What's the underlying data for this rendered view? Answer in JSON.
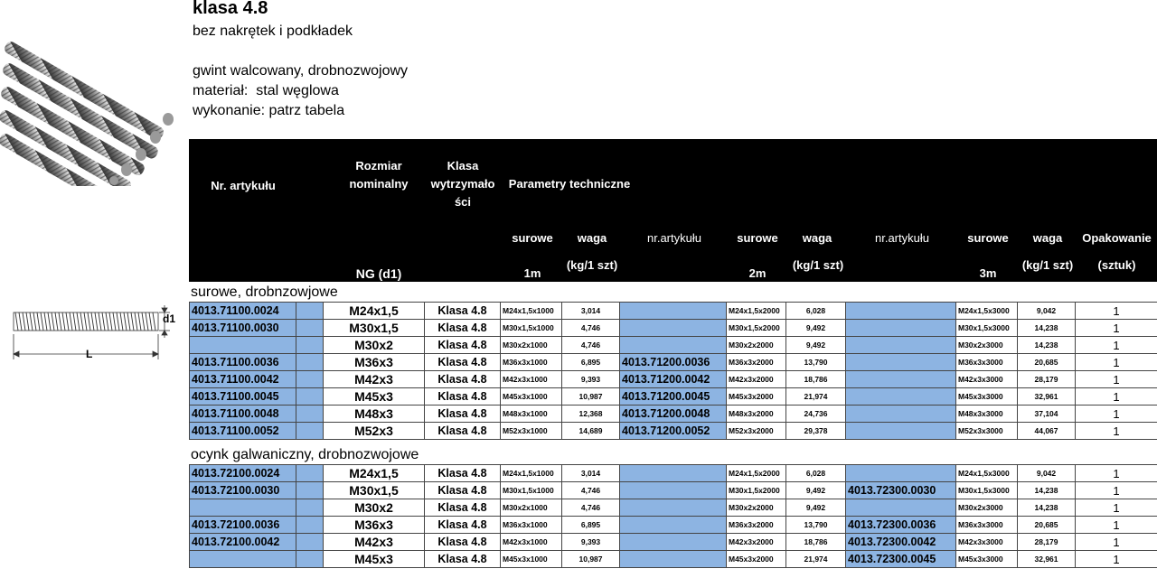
{
  "header": {
    "title": "klasa 4.8",
    "subtitle": "bez nakrętek i podkładek",
    "info_lines": [
      "gwint walcowany, drobnozwojowy",
      "materiał:  stal węglowa",
      "wykonanie: patrz tabela"
    ]
  },
  "drawing": {
    "dim_d1": "d1",
    "dim_L": "L"
  },
  "table_header": {
    "nr_artykulu": "Nr. artykułu",
    "rozmiar_line1": "Rozmiar",
    "rozmiar_line2": "nominalny",
    "klasa_line1": "Klasa",
    "klasa_line2": "wytrzymało",
    "klasa_line3": "ści",
    "parametry": "Parametry techniczne",
    "ng": "NG (d1)",
    "surowe1": "surowe",
    "len1": "1m",
    "waga1": "waga",
    "kg1": "(kg/1 szt)",
    "nr2": "nr.artykułu",
    "surowe2": "surowe",
    "len2": "2m",
    "waga2": "waga",
    "kg2": "(kg/1 szt)",
    "nr3": "nr.artykułu",
    "surowe3": "surowe",
    "len3": "3m",
    "waga3": "waga",
    "kg3": "(kg/1 szt)",
    "opak": "Opakowanie",
    "sztuk": "(sztuk)"
  },
  "sections": [
    {
      "label": "surowe, drobnzowjowe",
      "rows": [
        {
          "art1": "4013.71100.0024",
          "size": "M24x1,5",
          "cls": "Klasa 4.8",
          "r1": "M24x1,5x1000",
          "w1": "3,014",
          "art2": "",
          "r2": "M24x1,5x2000",
          "w2": "6,028",
          "art3": "",
          "r3": "M24x1,5x3000",
          "w3": "9,042",
          "pk": "1"
        },
        {
          "art1": "4013.71100.0030",
          "size": "M30x1,5",
          "cls": "Klasa 4.8",
          "r1": "M30x1,5x1000",
          "w1": "4,746",
          "art2": "",
          "r2": "M30x1,5x2000",
          "w2": "9,492",
          "art3": "",
          "r3": "M30x1,5x3000",
          "w3": "14,238",
          "pk": "1"
        },
        {
          "art1": "",
          "size": "M30x2",
          "cls": "Klasa 4.8",
          "r1": "M30x2x1000",
          "w1": "4,746",
          "art2": "",
          "r2": "M30x2x2000",
          "w2": "9,492",
          "art3": "",
          "r3": "M30x2x3000",
          "w3": "14,238",
          "pk": "1"
        },
        {
          "art1": "4013.71100.0036",
          "size": "M36x3",
          "cls": "Klasa 4.8",
          "r1": "M36x3x1000",
          "w1": "6,895",
          "art2": "4013.71200.0036",
          "r2": "M36x3x2000",
          "w2": "13,790",
          "art3": "",
          "r3": "M36x3x3000",
          "w3": "20,685",
          "pk": "1"
        },
        {
          "art1": "4013.71100.0042",
          "size": "M42x3",
          "cls": "Klasa 4.8",
          "r1": "M42x3x1000",
          "w1": "9,393",
          "art2": "4013.71200.0042",
          "r2": "M42x3x2000",
          "w2": "18,786",
          "art3": "",
          "r3": "M42x3x3000",
          "w3": "28,179",
          "pk": "1"
        },
        {
          "art1": "4013.71100.0045",
          "size": "M45x3",
          "cls": "Klasa 4.8",
          "r1": "M45x3x1000",
          "w1": "10,987",
          "art2": "4013.71200.0045",
          "r2": "M45x3x2000",
          "w2": "21,974",
          "art3": "",
          "r3": "M45x3x3000",
          "w3": "32,961",
          "pk": "1"
        },
        {
          "art1": "4013.71100.0048",
          "size": "M48x3",
          "cls": "Klasa 4.8",
          "r1": "M48x3x1000",
          "w1": "12,368",
          "art2": "4013.71200.0048",
          "r2": "M48x3x2000",
          "w2": "24,736",
          "art3": "",
          "r3": "M48x3x3000",
          "w3": "37,104",
          "pk": "1"
        },
        {
          "art1": "4013.71100.0052",
          "size": "M52x3",
          "cls": "Klasa 4.8",
          "r1": "M52x3x1000",
          "w1": "14,689",
          "art2": "4013.71200.0052",
          "r2": "M52x3x2000",
          "w2": "29,378",
          "art3": "",
          "r3": "M52x3x3000",
          "w3": "44,067",
          "pk": "1"
        }
      ]
    },
    {
      "label": "ocynk galwaniczny, drobnozwojowe",
      "rows": [
        {
          "art1": "4013.72100.0024",
          "size": "M24x1,5",
          "cls": "Klasa 4.8",
          "r1": "M24x1,5x1000",
          "w1": "3,014",
          "art2": "",
          "r2": "M24x1,5x2000",
          "w2": "6,028",
          "art3": "",
          "r3": "M24x1,5x3000",
          "w3": "9,042",
          "pk": "1"
        },
        {
          "art1": "4013.72100.0030",
          "size": "M30x1,5",
          "cls": "Klasa 4.8",
          "r1": "M30x1,5x1000",
          "w1": "4,746",
          "art2": "",
          "r2": "M30x1,5x2000",
          "w2": "9,492",
          "art3": "4013.72300.0030",
          "r3": "M30x1,5x3000",
          "w3": "14,238",
          "pk": "1"
        },
        {
          "art1": "",
          "size": "M30x2",
          "cls": "Klasa 4.8",
          "r1": "M30x2x1000",
          "w1": "4,746",
          "art2": "",
          "r2": "M30x2x2000",
          "w2": "9,492",
          "art3": "",
          "r3": "M30x2x3000",
          "w3": "14,238",
          "pk": "1"
        },
        {
          "art1": "4013.72100.0036",
          "size": "M36x3",
          "cls": "Klasa 4.8",
          "r1": "M36x3x1000",
          "w1": "6,895",
          "art2": "",
          "r2": "M36x3x2000",
          "w2": "13,790",
          "art3": "4013.72300.0036",
          "r3": "M36x3x3000",
          "w3": "20,685",
          "pk": "1"
        },
        {
          "art1": "4013.72100.0042",
          "size": "M42x3",
          "cls": "Klasa 4.8",
          "r1": "M42x3x1000",
          "w1": "9,393",
          "art2": "",
          "r2": "M42x3x2000",
          "w2": "18,786",
          "art3": "4013.72300.0042",
          "r3": "M42x3x3000",
          "w3": "28,179",
          "pk": "1"
        },
        {
          "art1": "",
          "size": "M45x3",
          "cls": "Klasa 4.8",
          "r1": "M45x3x1000",
          "w1": "10,987",
          "art2": "",
          "r2": "M45x3x2000",
          "w2": "21,974",
          "art3": "4013.72300.0045",
          "r3": "M45x3x3000",
          "w3": "32,961",
          "pk": "1"
        }
      ]
    }
  ]
}
